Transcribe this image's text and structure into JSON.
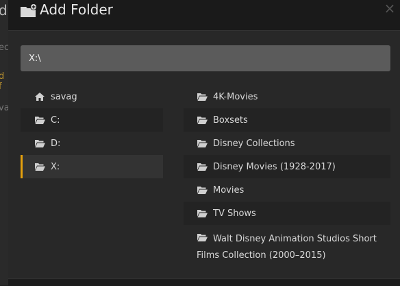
{
  "background": {
    "fragments": [
      "d",
      "ec",
      "d f",
      "va"
    ]
  },
  "dialog": {
    "title": "Add Folder",
    "close_glyph": "×",
    "icon": "folder-add-icon",
    "path_value": "X:\\"
  },
  "drives": [
    {
      "label": "savag",
      "icon": "home-icon"
    },
    {
      "label": "C:",
      "icon": "folder-open-icon"
    },
    {
      "label": "D:",
      "icon": "folder-open-icon"
    },
    {
      "label": "X:",
      "icon": "folder-open-icon",
      "selected": true
    }
  ],
  "folders": [
    {
      "label": "4K-Movies"
    },
    {
      "label": "Boxsets"
    },
    {
      "label": "Disney Collections"
    },
    {
      "label": "Disney Movies (1928-2017)"
    },
    {
      "label": "Movies"
    },
    {
      "label": "TV Shows"
    },
    {
      "label": "Walt Disney Animation Studios Short Films Collection (2000–2015)"
    }
  ],
  "colors": {
    "accent": "#e5a00d",
    "input_bg": "#5b5b5b",
    "header_bg": "#1a1a1a",
    "modal_bg": "#282828"
  }
}
